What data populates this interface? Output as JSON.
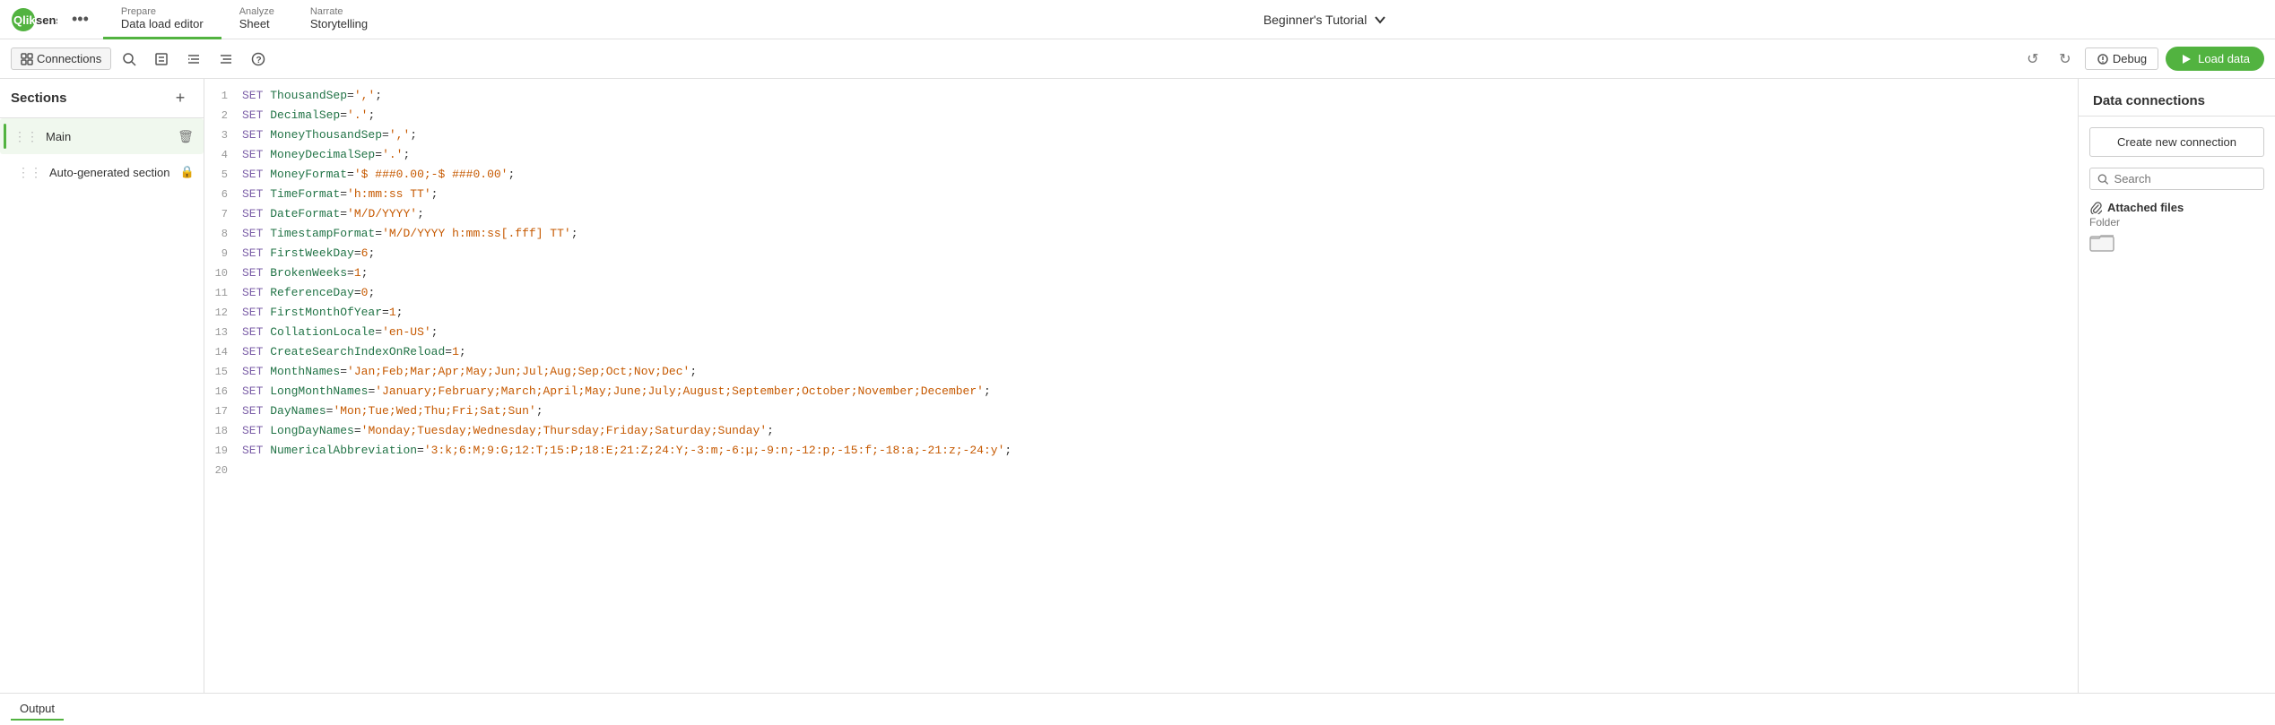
{
  "nav": {
    "logo_text": "Qlik",
    "dots_label": "•••",
    "tabs": [
      {
        "id": "prepare",
        "top": "Prepare",
        "sub": "Data load editor",
        "active": true,
        "has_arrow": true
      },
      {
        "id": "analyze",
        "top": "Analyze",
        "sub": "Sheet",
        "active": false,
        "has_arrow": false
      },
      {
        "id": "narrate",
        "top": "Narrate",
        "sub": "Storytelling",
        "active": false,
        "has_arrow": false
      }
    ],
    "app_title": "Beginner's Tutorial",
    "app_title_icon": "▾"
  },
  "toolbar": {
    "connections_label": "Connections",
    "undo_label": "↺",
    "redo_label": "↻",
    "debug_label": "Debug",
    "load_label": "Load data"
  },
  "sidebar": {
    "title": "Sections",
    "add_label": "+",
    "items": [
      {
        "id": "main",
        "label": "Main",
        "active": true,
        "has_delete": true,
        "has_lock": false
      },
      {
        "id": "auto",
        "label": "Auto-generated section",
        "active": false,
        "has_delete": false,
        "has_lock": true
      }
    ]
  },
  "editor": {
    "lines": [
      {
        "num": 1,
        "code": "SET ThousandSep=',';",
        "type": "set_str"
      },
      {
        "num": 2,
        "code": "SET DecimalSep='.';",
        "type": "set_str"
      },
      {
        "num": 3,
        "code": "SET MoneyThousandSep=',';",
        "type": "set_str"
      },
      {
        "num": 4,
        "code": "SET MoneyDecimalSep='.';",
        "type": "set_str"
      },
      {
        "num": 5,
        "code": "SET MoneyFormat='$ ###0.00;-$ ###0.00';",
        "type": "set_str"
      },
      {
        "num": 6,
        "code": "SET TimeFormat='h:mm:ss TT';",
        "type": "set_str"
      },
      {
        "num": 7,
        "code": "SET DateFormat='M/D/YYYY';",
        "type": "set_str"
      },
      {
        "num": 8,
        "code": "SET TimestampFormat='M/D/YYYY h:mm:ss[.fff] TT';",
        "type": "set_str"
      },
      {
        "num": 9,
        "code": "SET FirstWeekDay=6;",
        "type": "set_num"
      },
      {
        "num": 10,
        "code": "SET BrokenWeeks=1;",
        "type": "set_num"
      },
      {
        "num": 11,
        "code": "SET ReferenceDay=0;",
        "type": "set_num"
      },
      {
        "num": 12,
        "code": "SET FirstMonthOfYear=1;",
        "type": "set_num"
      },
      {
        "num": 13,
        "code": "SET CollationLocale='en-US';",
        "type": "set_str"
      },
      {
        "num": 14,
        "code": "SET CreateSearchIndexOnReload=1;",
        "type": "set_num"
      },
      {
        "num": 15,
        "code": "SET MonthNames='Jan;Feb;Mar;Apr;May;Jun;Jul;Aug;Sep;Oct;Nov;Dec';",
        "type": "set_str"
      },
      {
        "num": 16,
        "code": "SET LongMonthNames='January;February;March;April;May;June;July;August;September;October;November;December';",
        "type": "set_str"
      },
      {
        "num": 17,
        "code": "SET DayNames='Mon;Tue;Wed;Thu;Fri;Sat;Sun';",
        "type": "set_str"
      },
      {
        "num": 18,
        "code": "SET LongDayNames='Monday;Tuesday;Wednesday;Thursday;Friday;Saturday;Sunday';",
        "type": "set_str"
      },
      {
        "num": 19,
        "code": "SET NumericalAbbreviation='3:k;6:M;9:G;12:T;15:P;18:E;21:Z;24:Y;-3:m;-6:μ;-9:n;-12:p;-15:f;-18:a;-21:z;-24:y';",
        "type": "set_str"
      },
      {
        "num": 20,
        "code": "",
        "type": "empty"
      }
    ]
  },
  "right_panel": {
    "title": "Data connections",
    "create_connection_label": "Create new connection",
    "search_placeholder": "Search",
    "attached_files_label": "Attached files",
    "folder_label": "Folder"
  },
  "bottom": {
    "output_tab_label": "Output"
  }
}
